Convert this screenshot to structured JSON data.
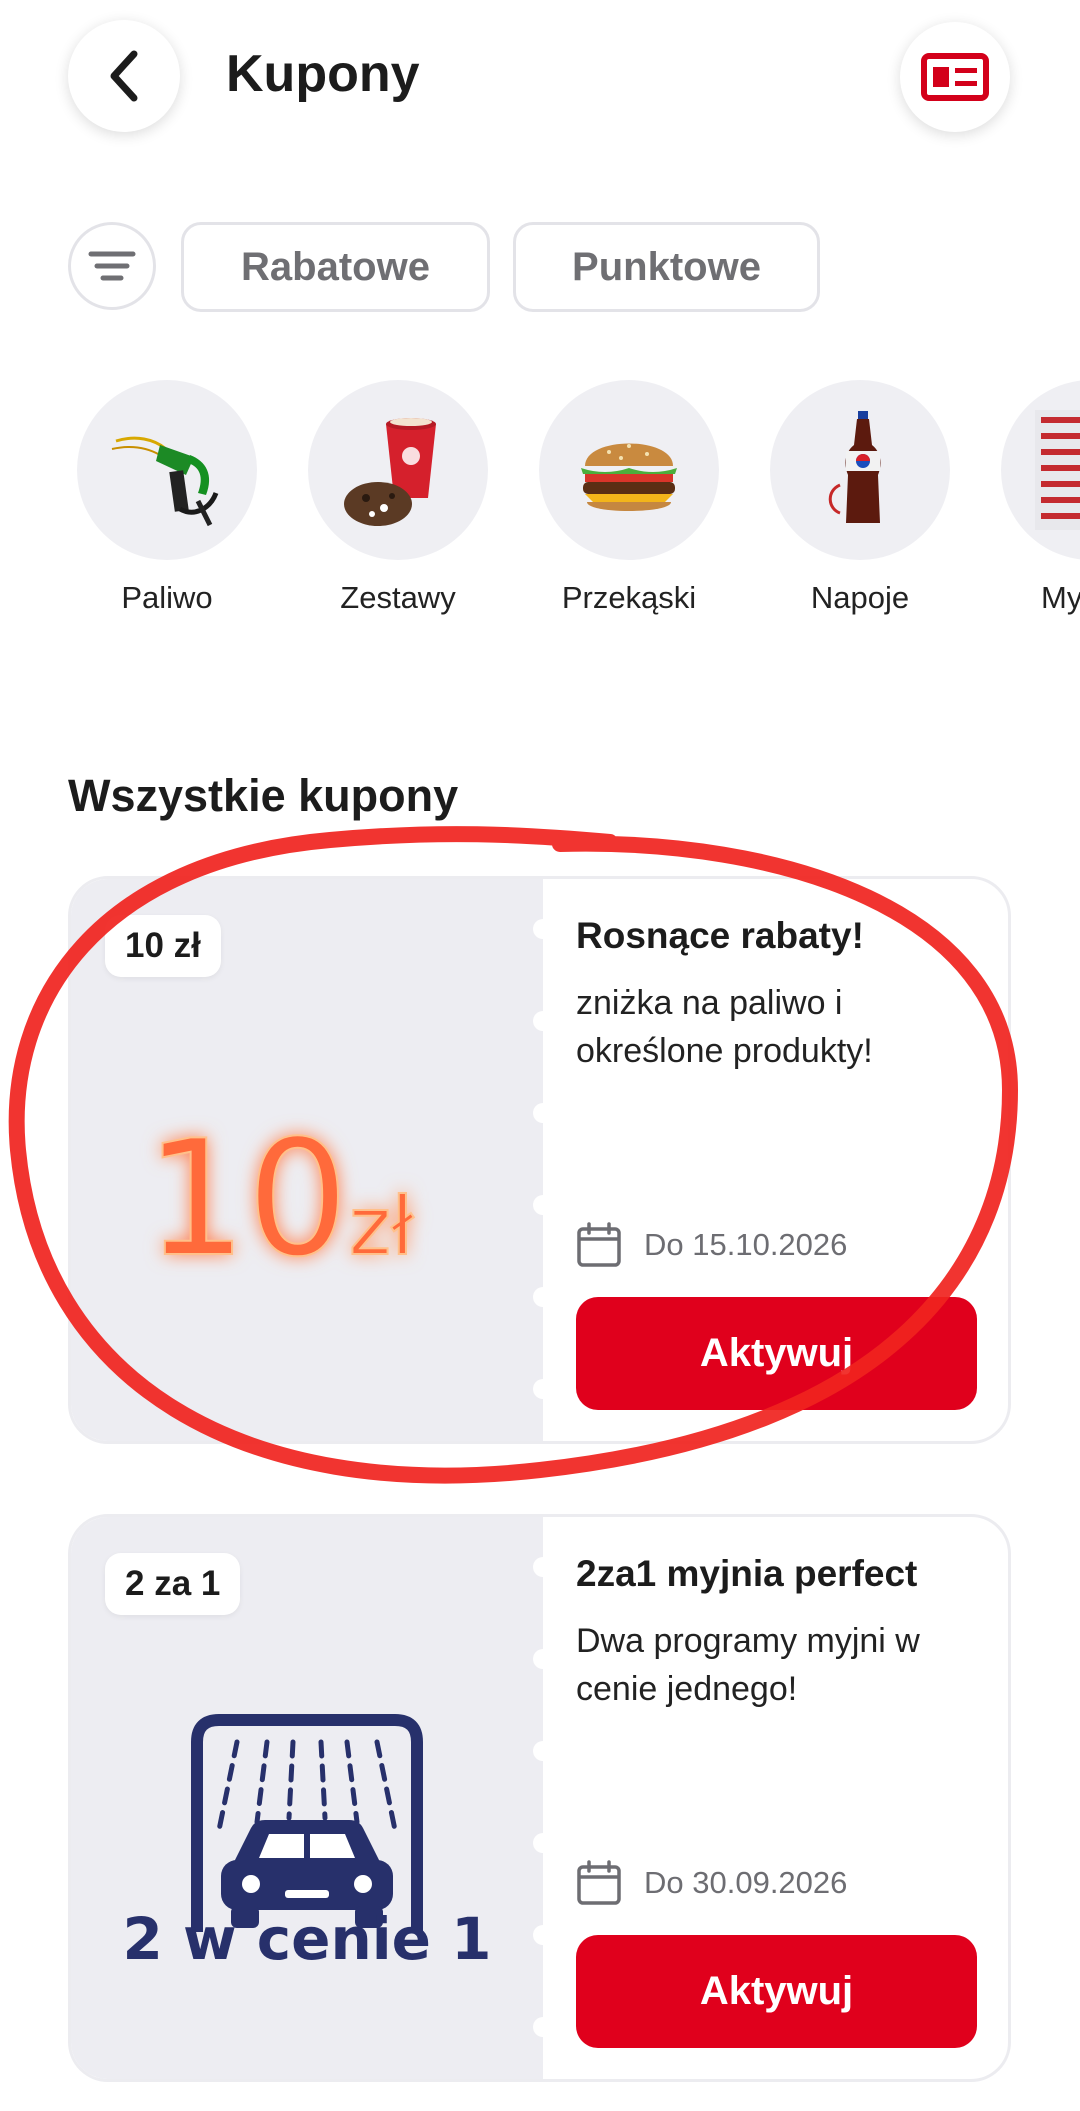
{
  "header": {
    "title": "Kupony",
    "back_icon": "chevron-left-icon",
    "card_icon": "id-card-icon"
  },
  "filters": {
    "filter_icon": "filter-lines-icon",
    "chips": [
      {
        "label": "Rabatowe"
      },
      {
        "label": "Punktowe"
      }
    ]
  },
  "categories": [
    {
      "label": "Paliwo",
      "icon": "fuel-nozzle-image"
    },
    {
      "label": "Zestawy",
      "icon": "coffee-cup-cookie-image"
    },
    {
      "label": "Przekąski",
      "icon": "burger-image"
    },
    {
      "label": "Napoje",
      "icon": "soda-bottle-image"
    },
    {
      "label": "My",
      "icon": "car-wash-brush-image"
    }
  ],
  "section": {
    "title": "Wszystkie kupony"
  },
  "coupons": [
    {
      "badge": "10 zł",
      "art_text_number": "10",
      "art_text_unit": "zł",
      "title": "Rosnące rabaty!",
      "description": "zniżka na paliwo i określone produkty!",
      "date": "Do 15.10.2026",
      "button": "Aktywuj"
    },
    {
      "badge": "2 za 1",
      "art_caption": "2 w cenie 1",
      "title": "2za1 myjnia perfect",
      "description": "Dwa programy myjni w cenie jednego!",
      "date": "Do 30.09.2026",
      "button": "Aktywuj"
    }
  ],
  "colors": {
    "brand_red": "#e0001c",
    "annotation_red": "#f0231e",
    "car_wash_navy": "#27306b",
    "neon_orange": "#ff6a3a"
  }
}
